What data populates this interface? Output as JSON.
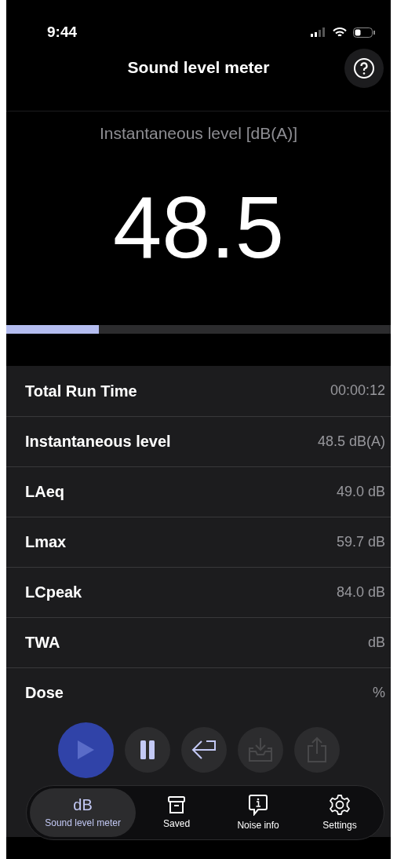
{
  "status_bar": {
    "time": "9:44"
  },
  "header": {
    "title": "Sound level meter"
  },
  "meter": {
    "label": "Instantaneous level [dB(A)]",
    "value": "48.5",
    "level": 0.24
  },
  "rows": [
    {
      "label": "Total Run Time",
      "value": "00:00:12"
    },
    {
      "label": "Instantaneous level",
      "value": "48.5 dB(A)"
    },
    {
      "label": "LAeq",
      "value": "49.0 dB"
    },
    {
      "label": "Lmax",
      "value": "59.7 dB"
    },
    {
      "label": "LCpeak",
      "value": "84.0 dB"
    },
    {
      "label": "TWA",
      "value": "dB"
    },
    {
      "label": "Dose",
      "value": "%"
    }
  ],
  "controls": [
    {
      "kind": "play",
      "disabled": false
    },
    {
      "kind": "pause",
      "disabled": false
    },
    {
      "kind": "return",
      "disabled": false
    },
    {
      "kind": "download",
      "disabled": true
    },
    {
      "kind": "share",
      "disabled": true
    }
  ],
  "tabs": [
    {
      "kind": "meter",
      "icon_text": "dB",
      "label": "Sound level meter",
      "selected": true
    },
    {
      "kind": "saved",
      "label": "Saved",
      "selected": false
    },
    {
      "kind": "info",
      "label": "Noise info",
      "selected": false
    },
    {
      "kind": "settings",
      "label": "Settings",
      "selected": false
    }
  ]
}
